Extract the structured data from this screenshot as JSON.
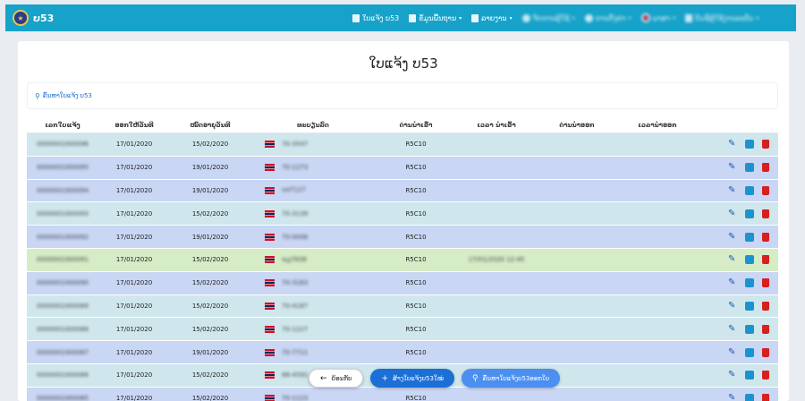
{
  "navbar": {
    "brand": "ບ53",
    "logo_glyph": "★",
    "items": [
      {
        "label": "ໃບແຈ້ງ ບ53",
        "icon": "document-icon",
        "dropdown": false,
        "blurred": false
      },
      {
        "label": "ຂໍ້ມູນພື້ນຖານ",
        "icon": "document-icon",
        "dropdown": true,
        "blurred": false
      },
      {
        "label": "ລາຍງານ",
        "icon": "document-icon",
        "dropdown": true,
        "blurred": false
      },
      {
        "label": "ຈັດການຜູ້ໃຊ້",
        "icon": "users-icon",
        "dropdown": true,
        "blurred": true
      },
      {
        "label": "ການຕັ້ງຄ່າ",
        "icon": "settings-icon",
        "dropdown": true,
        "blurred": true
      },
      {
        "label": "ພາສາ",
        "icon": "flag-icon",
        "dropdown": true,
        "blurred": true
      },
      {
        "label": "ບັນຊີຜູ້ໃຊ້ງານລະບົບ",
        "icon": "clipboard-icon",
        "dropdown": true,
        "blurred": true
      }
    ]
  },
  "page": {
    "title": "ໃບແຈ້ງ ບ53",
    "search_label": "ຄົ້ນຫາໃບແຈ້ງ ບ53"
  },
  "table": {
    "headers": [
      "ເລກໃບແຈ້ງ",
      "ອອກໃຫ້ວັນທີ",
      "ໝົດອາຍຸວັນທີ",
      "ທະບຽນລົດ",
      "ດ່ານນຳເຂົ້າ",
      "ເວລາ ນຳເຂົ້າ",
      "ດ່ານນຳອອກ",
      "ເວລານຳອອກ",
      ""
    ],
    "rows": [
      {
        "id": "0000001000096",
        "issued": "17/01/2020",
        "expiry": "15/02/2020",
        "plate": "70-3547",
        "port_in": "R5C10",
        "time_in": "",
        "port_out": "",
        "time_out": "",
        "color": "teal"
      },
      {
        "id": "0000001000095",
        "issued": "17/01/2020",
        "expiry": "19/01/2020",
        "plate": "70-1273",
        "port_in": "R5C10",
        "time_in": "",
        "port_out": "",
        "time_out": "",
        "color": "blue"
      },
      {
        "id": "0000001000094",
        "issued": "17/01/2020",
        "expiry": "19/01/2020",
        "plate": "บท7127",
        "port_in": "R5C10",
        "time_in": "",
        "port_out": "",
        "time_out": "",
        "color": "blue"
      },
      {
        "id": "0000001000093",
        "issued": "17/01/2020",
        "expiry": "15/02/2020",
        "plate": "70-3139",
        "port_in": "R5C10",
        "time_in": "",
        "port_out": "",
        "time_out": "",
        "color": "teal"
      },
      {
        "id": "0000001000092",
        "issued": "17/01/2020",
        "expiry": "19/01/2020",
        "plate": "70-0006",
        "port_in": "R5C10",
        "time_in": "",
        "port_out": "",
        "time_out": "",
        "color": "blue"
      },
      {
        "id": "0000001000091",
        "issued": "17/01/2020",
        "expiry": "15/02/2020",
        "plate": "ฆฎ7838",
        "port_in": "R5C10",
        "time_in": "17/01/2020 12:45",
        "port_out": "",
        "time_out": "",
        "color": "green"
      },
      {
        "id": "0000001000090",
        "issued": "17/01/2020",
        "expiry": "15/02/2020",
        "plate": "70-3163",
        "port_in": "R5C10",
        "time_in": "",
        "port_out": "",
        "time_out": "",
        "color": "blue"
      },
      {
        "id": "0000001000089",
        "issued": "17/01/2020",
        "expiry": "15/02/2020",
        "plate": "70-4187",
        "port_in": "R5C10",
        "time_in": "",
        "port_out": "",
        "time_out": "",
        "color": "teal"
      },
      {
        "id": "0000001000088",
        "issued": "17/01/2020",
        "expiry": "15/02/2020",
        "plate": "70-1227",
        "port_in": "R5C10",
        "time_in": "",
        "port_out": "",
        "time_out": "",
        "color": "teal"
      },
      {
        "id": "0000001000087",
        "issued": "17/01/2020",
        "expiry": "19/01/2020",
        "plate": "70-7711",
        "port_in": "R5C10",
        "time_in": "",
        "port_out": "",
        "time_out": "",
        "color": "blue"
      },
      {
        "id": "0000001000086",
        "issued": "17/01/2020",
        "expiry": "15/02/2020",
        "plate": "88-4592",
        "port_in": "R5C10",
        "time_in": "",
        "port_out": "",
        "time_out": "",
        "color": "teal"
      },
      {
        "id": "0000001000085",
        "issued": "17/01/2020",
        "expiry": "15/02/2020",
        "plate": "70-1123",
        "port_in": "R5C10",
        "time_in": "",
        "port_out": "",
        "time_out": "",
        "color": "blue"
      }
    ],
    "row_colors": {
      "blue": "#c9d6f4",
      "teal": "#cfe7ec",
      "green": "#d5ecc7"
    }
  },
  "actions": {
    "back_label": "ຍ້ອນກັບ",
    "add_label": "ສ້າງໃບແຈ້ງບ53ໃໝ່",
    "find_label": "ຄົ້ນຫາໃບແຈ້ງບ53ອອກໃບ"
  },
  "colors": {
    "navbar": "#17a2c9",
    "primary": "#1b6fd6",
    "edit_icon": "#1a56b8",
    "print_icon": "#1b93cf",
    "delete_icon": "#d61f1f"
  }
}
